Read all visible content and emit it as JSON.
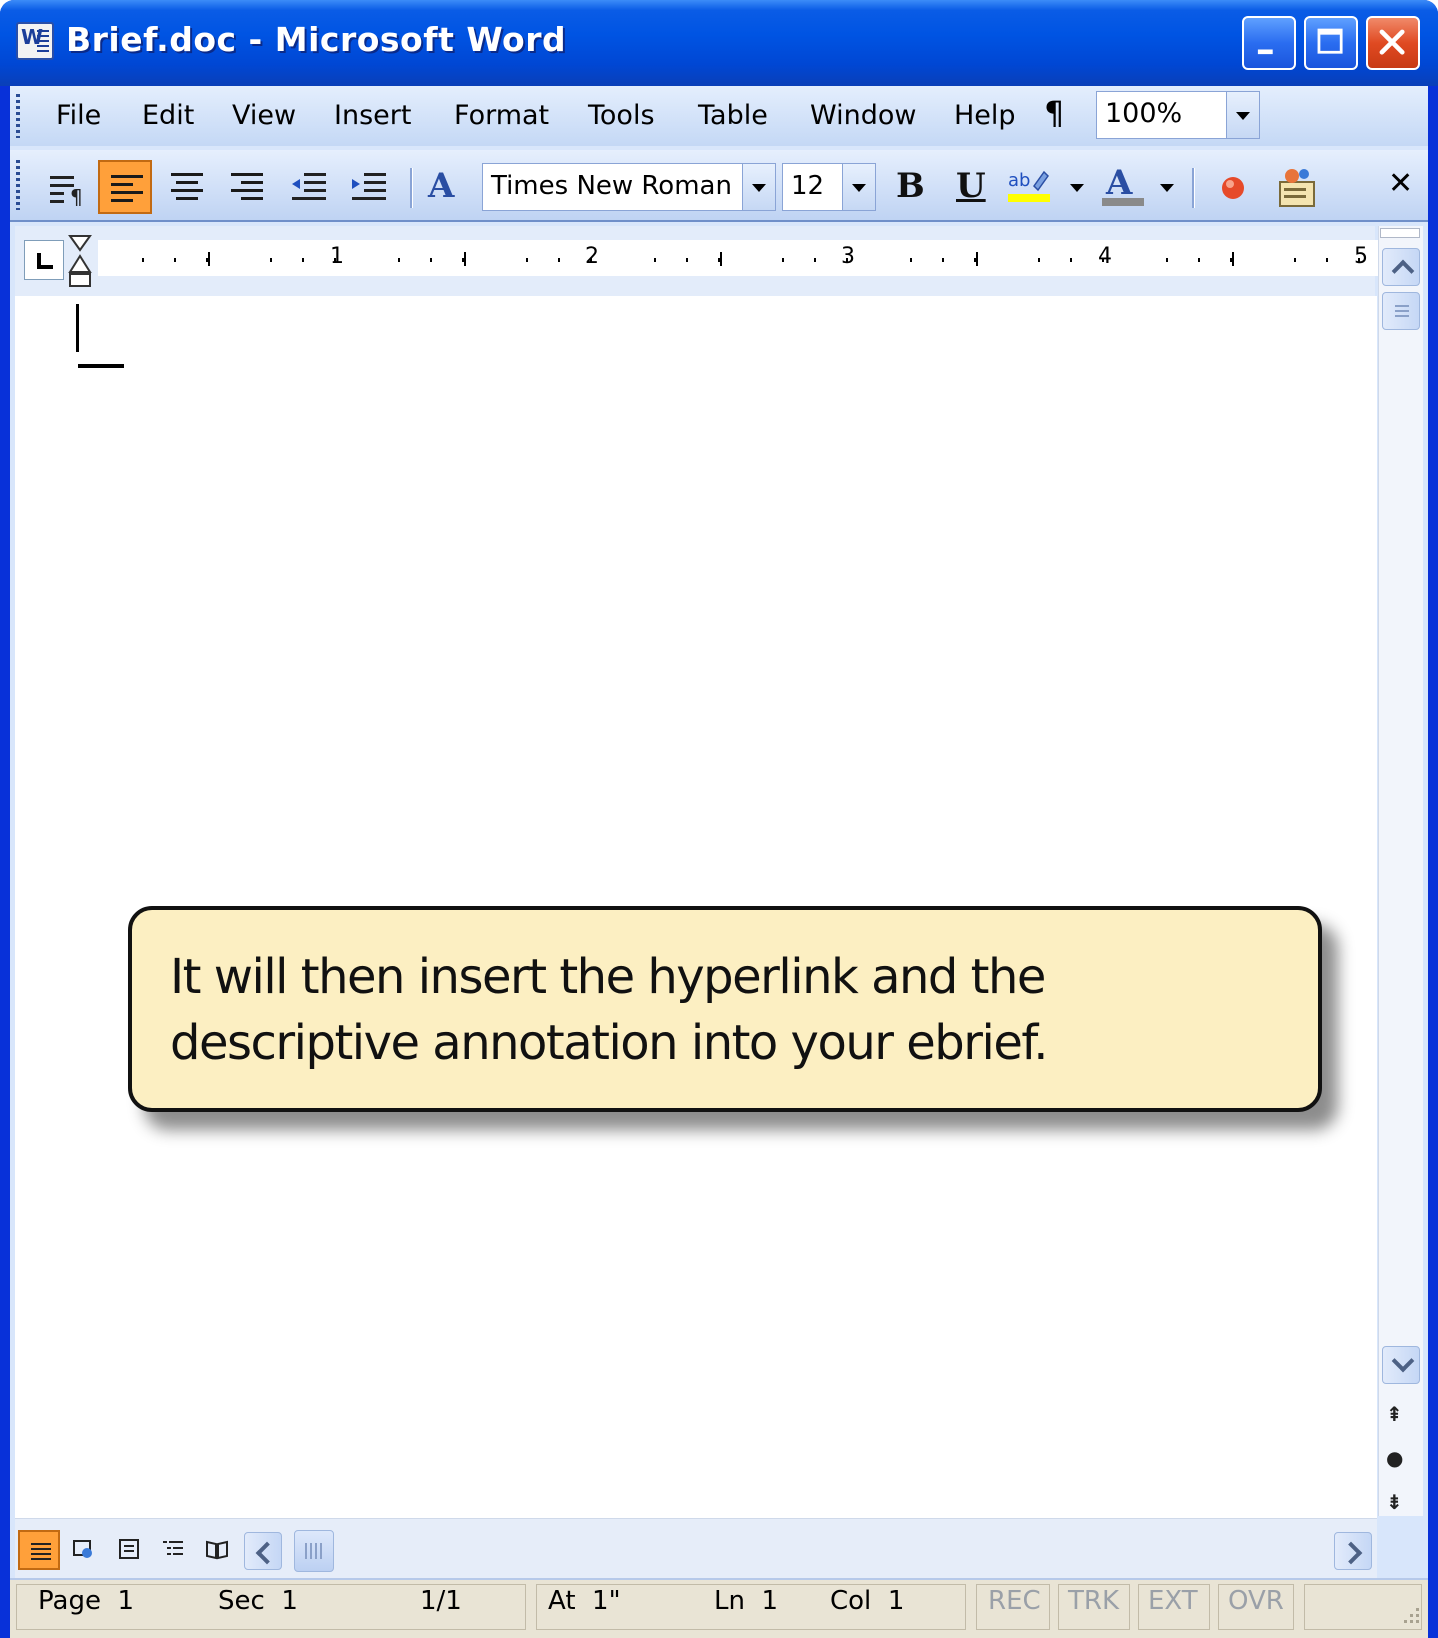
{
  "window": {
    "title": "Brief.doc - Microsoft Word"
  },
  "menu": {
    "items": [
      "File",
      "Edit",
      "View",
      "Insert",
      "Format",
      "Tools",
      "Table",
      "Window",
      "Help"
    ],
    "zoom": "100%"
  },
  "toolbar": {
    "font_name": "Times New Roman",
    "font_size": "12",
    "bold": "B",
    "underline": "U",
    "font_color_letter": "A",
    "styles_letter": "A"
  },
  "ruler": {
    "numbers": [
      "1",
      "2",
      "3",
      "4",
      "5"
    ]
  },
  "callout": {
    "text": "It will then insert the hyperlink and the descriptive annotation into your ebrief."
  },
  "status": {
    "page": "Page  1",
    "section": "Sec  1",
    "pages": "1/1",
    "at": "At  1\"",
    "line": "Ln  1",
    "col": "Col  1",
    "rec": "REC",
    "trk": "TRK",
    "ext": "EXT",
    "ovr": "OVR"
  },
  "colors": {
    "titlebar": "#0054e3",
    "active_button": "#ffa03a",
    "callout_fill": "#fcefc2",
    "close_button": "#e04a22"
  }
}
